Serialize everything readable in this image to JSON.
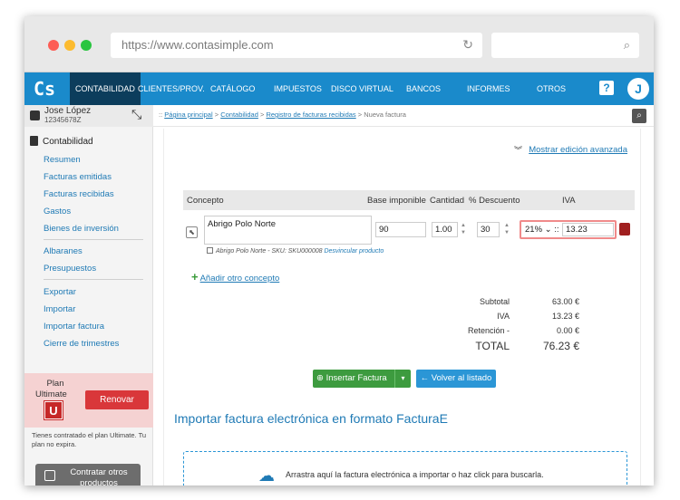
{
  "browser": {
    "url": "https://www.contasimple.com"
  },
  "nav": {
    "logo": "Cs",
    "items": [
      "CONTABILIDAD",
      "CLIENTES/PROV.",
      "CATÁLOGO",
      "IMPUESTOS",
      "DISCO VIRTUAL",
      "BANCOS",
      "INFORMES",
      "OTROS"
    ],
    "help": "?",
    "avatar": "J"
  },
  "user": {
    "name": "Jose López",
    "id": "12345678Z"
  },
  "sidebar": {
    "section": "Contabilidad",
    "group1": [
      "Resumen",
      "Facturas emitidas",
      "Facturas recibidas",
      "Gastos",
      "Bienes de inversión"
    ],
    "group2": [
      "Albaranes",
      "Presupuestos"
    ],
    "group3": [
      "Exportar",
      "Importar",
      "Importar factura",
      "Cierre de trimestres"
    ],
    "plan_label": "Plan",
    "plan_name": "Ultimate",
    "plan_letter": "U",
    "renew": "Renovar",
    "plan_info": "Tienes contratado el plan Ultimate. Tu plan no expira.",
    "contract": "Contratar otros productos"
  },
  "breadcrumb": {
    "sep": "::",
    "items": [
      "Página principal",
      "Contabilidad",
      "Registro de facturas recibidas"
    ],
    "current": "Nueva factura"
  },
  "editor": {
    "advanced_link": "Mostrar edición avanzada",
    "headers": {
      "concept": "Concepto",
      "base": "Base imponible",
      "qty": "Cantidad",
      "discount": "% Descuento",
      "iva": "IVA"
    },
    "row": {
      "concept": "Abrigo Polo Norte",
      "base": "90",
      "qty": "1.00",
      "discount": "30",
      "iva_rate": "21%",
      "iva_value": "13.23",
      "sku_text": "Abrigo Polo Norte - SKU: SKU000008",
      "unlink": "Desvincular producto"
    },
    "add_concept": "Añadir otro concepto",
    "totals": {
      "subtotal_label": "Subtotal",
      "subtotal": "63.00 €",
      "iva_label": "IVA",
      "iva": "13.23 €",
      "retention_label": "Retención -",
      "retention": "0.00 €",
      "total_label": "TOTAL",
      "total": "76.23 €"
    },
    "insert_button": "Insertar Factura",
    "back_button": "Volver al listado"
  },
  "import": {
    "title": "Importar factura electrónica en formato FacturaE",
    "drop_text": "Arrastra aquí la factura electrónica a importar o haz click para buscarla."
  },
  "colors": {
    "nav": "#1a8acb",
    "nav_active": "#0c3d5c",
    "link": "#1f7ab5",
    "renew": "#d9373a",
    "insert": "#3d9b3f",
    "back": "#2b96d6"
  }
}
